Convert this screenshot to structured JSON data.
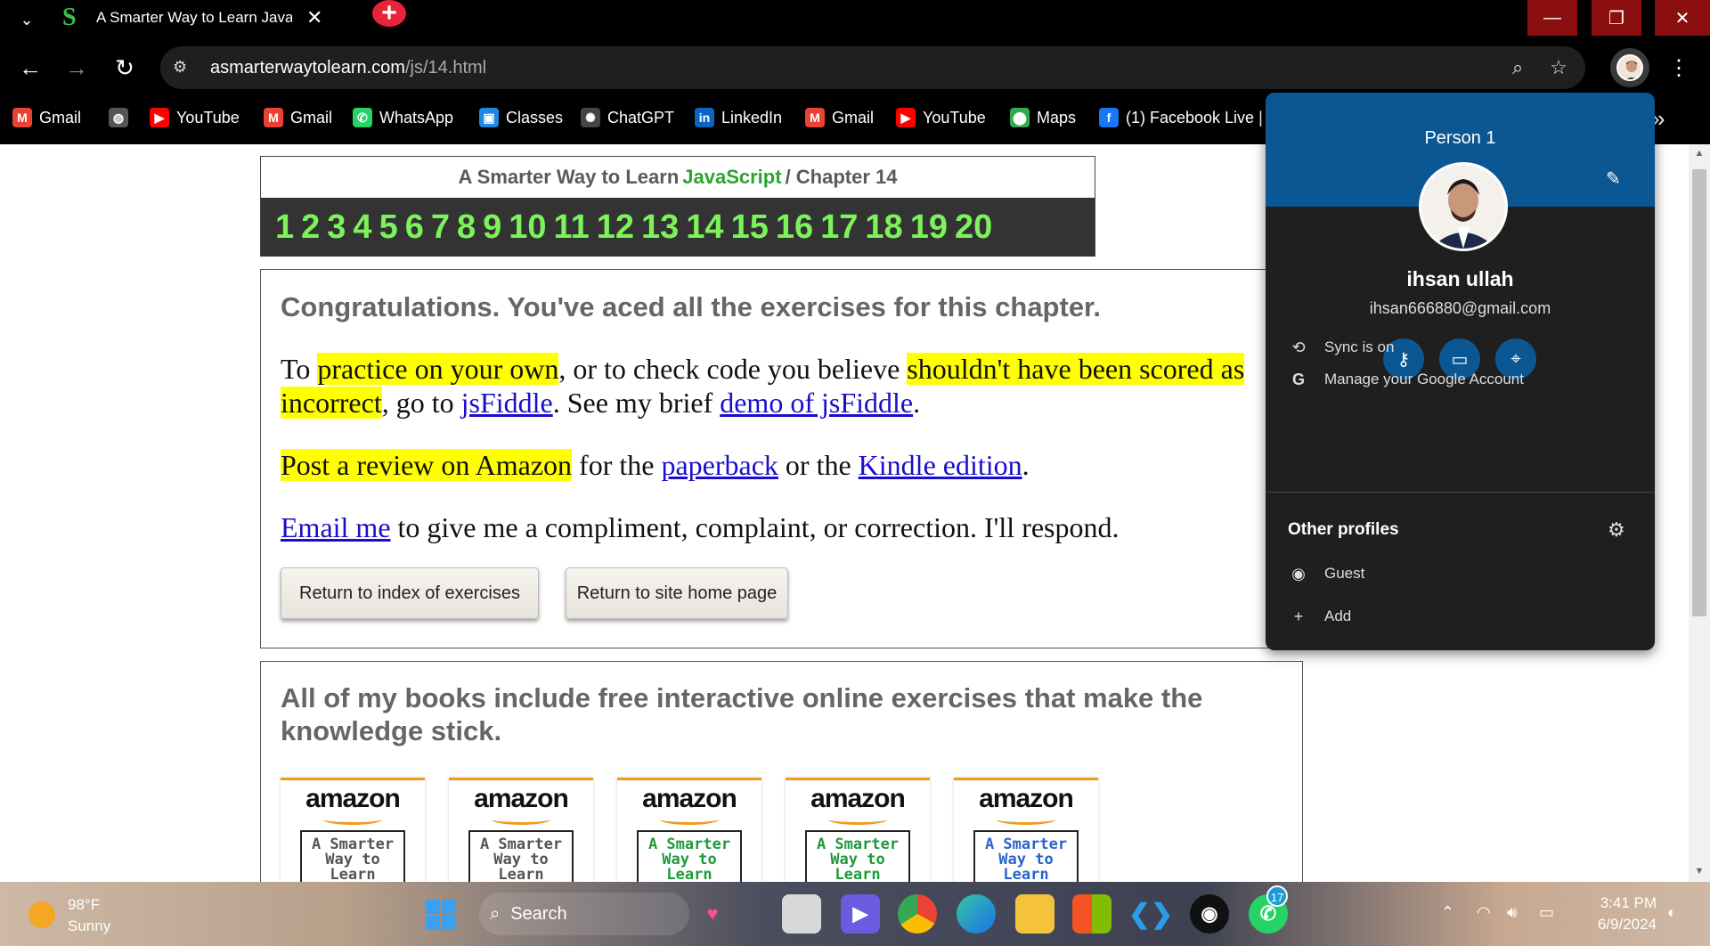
{
  "browser": {
    "tab": {
      "title": "A Smarter Way to Learn JavaScr",
      "favicon": "S"
    },
    "new_tab_symbol": "+",
    "window_controls": {
      "minimize": "—",
      "maximize": "❐",
      "close": "✕"
    },
    "url_host": "asmarterwaytolearn.com",
    "url_path": "/js/14.html",
    "bookmarks": [
      {
        "label": "Gmail",
        "icon": "gmail-icon",
        "glyph": "M",
        "color": "#ea4335"
      },
      {
        "label": "",
        "icon": "globe-icon",
        "glyph": "◍",
        "color": "#555"
      },
      {
        "label": "YouTube",
        "icon": "youtube-icon",
        "glyph": "▶",
        "color": "#ff0000"
      },
      {
        "label": "Gmail",
        "icon": "gmail-icon",
        "glyph": "M",
        "color": "#ea4335"
      },
      {
        "label": "WhatsApp",
        "icon": "whatsapp-icon",
        "glyph": "✆",
        "color": "#25d366"
      },
      {
        "label": "Classes",
        "icon": "classroom-icon",
        "glyph": "▣",
        "color": "#1e88e5"
      },
      {
        "label": "ChatGPT",
        "icon": "chatgpt-icon",
        "glyph": "✺",
        "color": "#444"
      },
      {
        "label": "LinkedIn",
        "icon": "linkedin-icon",
        "glyph": "in",
        "color": "#0a66c2"
      },
      {
        "label": "Gmail",
        "icon": "gmail-icon",
        "glyph": "M",
        "color": "#ea4335"
      },
      {
        "label": "YouTube",
        "icon": "youtube-icon",
        "glyph": "▶",
        "color": "#ff0000"
      },
      {
        "label": "Maps",
        "icon": "maps-icon",
        "glyph": "⬤",
        "color": "#34a853"
      },
      {
        "label": "(1) Facebook Live |",
        "icon": "facebook-icon",
        "glyph": "f",
        "color": "#1877f2"
      }
    ],
    "bookmarks_more": "»"
  },
  "page": {
    "chapter_header": {
      "prefix": "A Smarter Way to Learn",
      "js": "JavaScript",
      "suffix": "/  Chapter 14"
    },
    "chapter_numbers": [
      "1",
      "2",
      "3",
      "4",
      "5",
      "6",
      "7",
      "8",
      "9",
      "10",
      "11",
      "12",
      "13",
      "14",
      "15",
      "16",
      "17",
      "18",
      "19",
      "20"
    ],
    "congrats_title": "Congratulations. You've aced all the exercises for this chapter.",
    "para1": {
      "t1": "To ",
      "hl1": "practice on your own",
      "t2": ", or to check code you believe ",
      "hl2": "shouldn't have been scored as incorrect",
      "t3": ", go to ",
      "link1": "jsFiddle",
      "t4": ". See my brief ",
      "link2": "demo of jsFiddle",
      "t5": "."
    },
    "para2": {
      "hl": "Post a review on Amazon",
      "t1": " for the ",
      "link1": "paperback",
      "t2": " or the ",
      "link2": "Kindle edition",
      "t3": "."
    },
    "para3": {
      "link": "Email me",
      "t1": " to give me a compliment, complaint, or correction. I'll respond."
    },
    "buttons": {
      "index": "Return to index of exercises",
      "home": "Return to site home page"
    },
    "books_title": "All of my books include free interactive online exercises that make the knowledge stick.",
    "books": [
      {
        "brand": "amazon",
        "cover": "A Smarter Way to Learn Python",
        "cover_color": "#555"
      },
      {
        "brand": "amazon",
        "cover": "A Smarter Way to Learn Python",
        "cover_color": "#555"
      },
      {
        "brand": "amazon",
        "cover": "A Smarter Way to Learn",
        "cover_color": "#1f9a3b"
      },
      {
        "brand": "amazon",
        "cover": "A Smarter Way to Learn",
        "cover_color": "#1f9a3b"
      },
      {
        "brand": "amazon",
        "cover": "A Smarter Way to Learn",
        "cover_color": "#2a63c9"
      }
    ]
  },
  "profile_menu": {
    "person_label": "Person 1",
    "name": "ihsan ullah",
    "email": "ihsan666880@gmail.com",
    "sync": "Sync is on",
    "manage": "Manage your Google Account",
    "other_profiles": "Other profiles",
    "guest": "Guest",
    "add": "Add"
  },
  "taskbar": {
    "temperature": "98°F",
    "condition": "Sunny",
    "search_label": "Search",
    "whatsapp_badge": "17",
    "time": "3:41 PM",
    "date": "6/9/2024"
  },
  "colors": {
    "profile_header": "#0b5794",
    "highlight": "#ffff00",
    "link": "#1a0dcc",
    "chapter_numbers": "#7cf25b",
    "js_green": "#2da32d"
  }
}
